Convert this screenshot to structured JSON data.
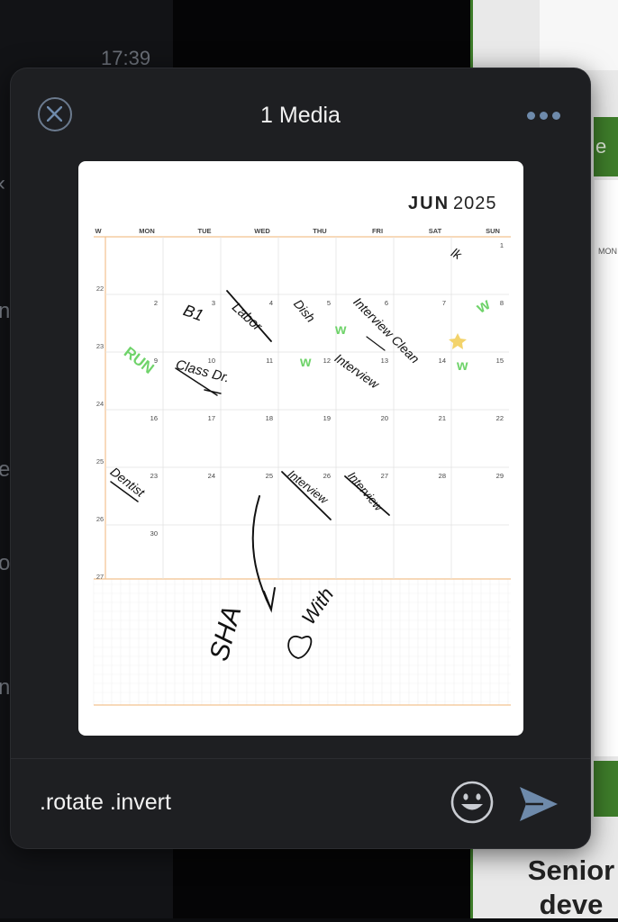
{
  "background": {
    "time": "17:39",
    "right_button_fragment": "e",
    "right_day_header_fragment": "MON",
    "right_heading": "Senior deve"
  },
  "modal": {
    "title": "1 Media",
    "caption_value": ".rotate .invert"
  },
  "calendar": {
    "month": "JUN",
    "year": "2025",
    "day_headers": [
      "W",
      "MON",
      "TUE",
      "WED",
      "THU",
      "FRI",
      "SAT",
      "SUN"
    ],
    "week_numbers": [
      "22",
      "23",
      "24",
      "25",
      "26",
      "27"
    ],
    "dates": [
      [
        "",
        "",
        "",
        "",
        "",
        "",
        "1"
      ],
      [
        "2",
        "3",
        "4",
        "5",
        "6",
        "7",
        "8"
      ],
      [
        "9",
        "10",
        "11",
        "12",
        "13",
        "14",
        "15"
      ],
      [
        "16",
        "17",
        "18",
        "19",
        "20",
        "21",
        "22"
      ],
      [
        "23",
        "24",
        "25",
        "26",
        "27",
        "28",
        "29"
      ],
      [
        "30",
        "",
        "",
        "",
        "",
        "",
        ""
      ]
    ],
    "handwriting": {
      "b1": "B1",
      "labor": "Labor",
      "dish": "Dish",
      "interview_clean": "Interview Clean",
      "run": "RUN",
      "class_dr": "Class Dr.",
      "interview_13": "Interview",
      "dentist": "Dentist",
      "interview_26": "Interview",
      "interview_27": "Interview",
      "sha": "SHA",
      "with": "With",
      "sat_mark": "lk",
      "w": "w"
    }
  },
  "colors": {
    "modal_bg": "#1e1f22",
    "accent_icon": "#6e8aab",
    "calendar_rule": "#f2c28f",
    "green_marks": "#6fd36a",
    "yellow_star": "#f3d36b"
  },
  "icons": {
    "close": "close-circle-icon",
    "more": "more-horizontal-icon",
    "emoji": "smile-emoji-icon",
    "send": "send-arrow-icon"
  }
}
